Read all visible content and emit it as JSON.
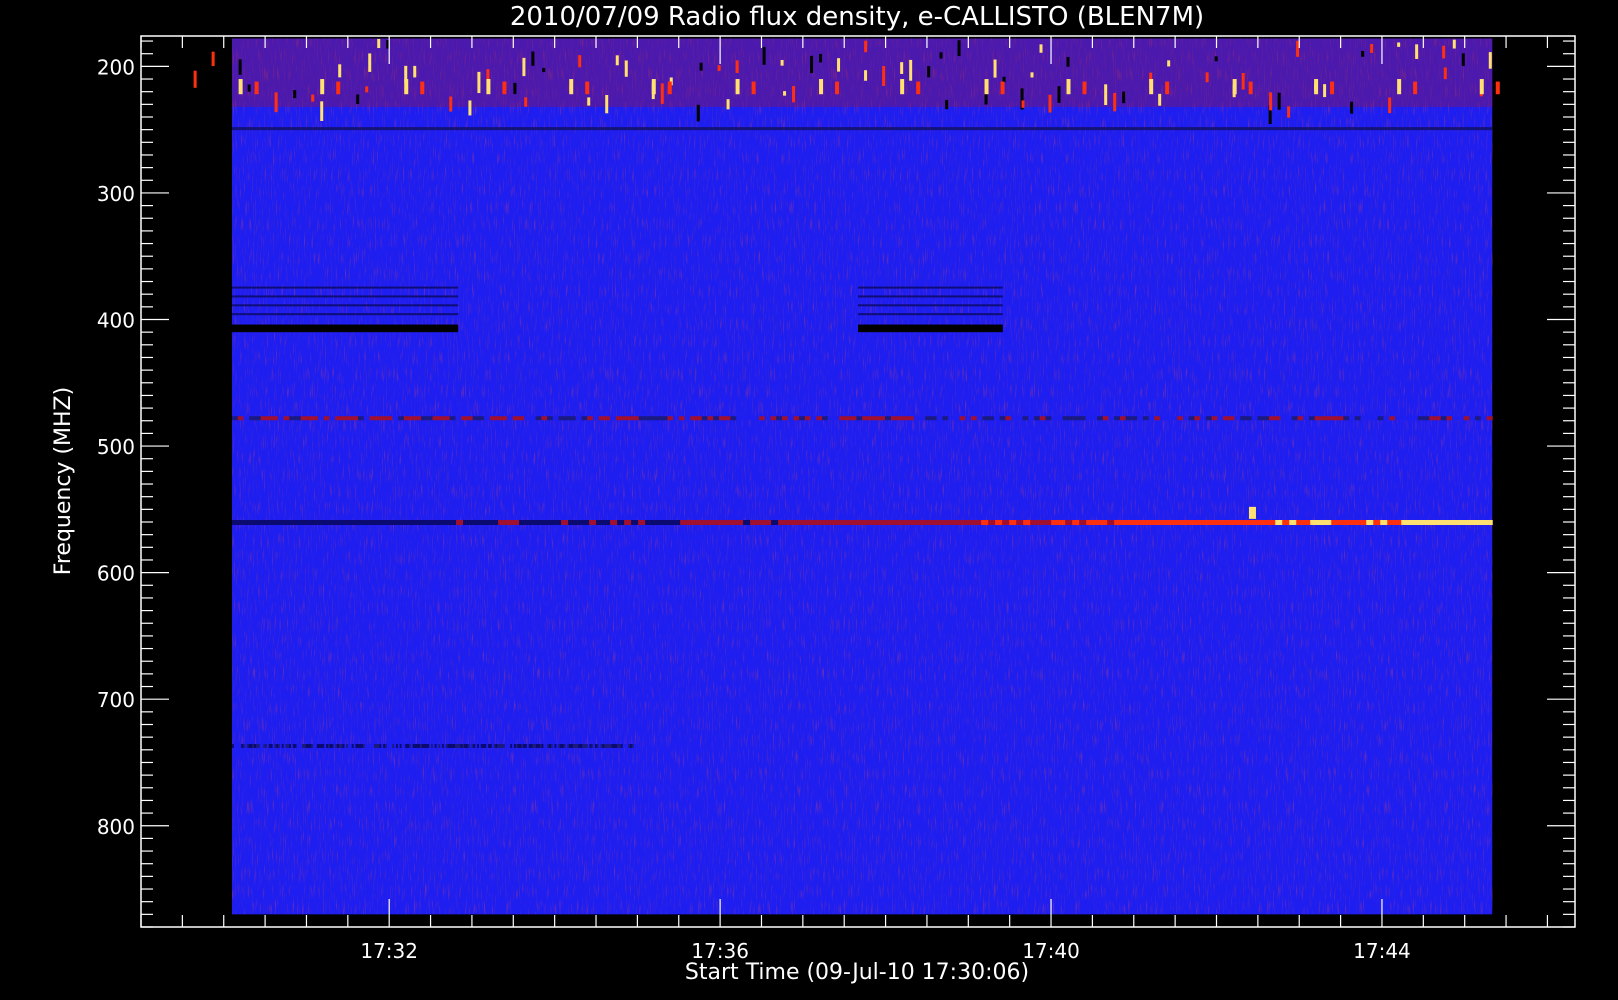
{
  "chart_data": {
    "type": "heatmap",
    "title": "2010/07/09  Radio flux density, e-CALLISTO (BLEN7M)",
    "xlabel": "Start Time (09-Jul-10 17:30:06)",
    "ylabel": "Frequency (MHZ)",
    "x_axis": {
      "unit": "minutes",
      "range": [
        "17:29:00",
        "17:46:20"
      ],
      "data_extent": [
        "17:30:06",
        "17:45:20"
      ],
      "major_ticks": [
        "17:32",
        "17:36",
        "17:40",
        "17:44"
      ],
      "minor_tick_step_minutes": 0.5,
      "ticks_on_top_axis": true
    },
    "y_axis": {
      "unit": "MHz",
      "inverted": true,
      "range": [
        176,
        880
      ],
      "data_extent": [
        178,
        870
      ],
      "major_ticks": [
        200,
        300,
        400,
        500,
        600,
        700,
        800
      ],
      "minor_tick_step": 10,
      "ticks_on_right_axis": true
    },
    "colormap": {
      "low": "#000000",
      "background": "#1e1ef0",
      "mid": "#a01030",
      "high": "#ff3010",
      "peak": "#ffe070"
    },
    "features": [
      {
        "name": "periodic interference bursts",
        "freq_range_mhz": [
          178,
          232
        ],
        "time_range": [
          "17:30:06",
          "17:45:20"
        ],
        "period_seconds": 60,
        "intensity": "high"
      },
      {
        "name": "dark band",
        "freq_range_mhz": [
          404,
          410
        ],
        "time_range": [
          "17:30:06",
          "17:32:50"
        ],
        "intensity": "very low"
      },
      {
        "name": "dark band",
        "freq_range_mhz": [
          404,
          410
        ],
        "time_range": [
          "17:37:40",
          "17:39:25"
        ],
        "intensity": "very low"
      },
      {
        "name": "narrowband emission line",
        "freq_mhz": 560,
        "time_range": [
          "17:30:06",
          "17:45:20"
        ],
        "intensity_start": "low",
        "intensity_end": "peak"
      },
      {
        "name": "emission line",
        "freq_mhz": 478,
        "time_range": [
          "17:30:06",
          "17:45:20"
        ],
        "intensity": "medium"
      },
      {
        "name": "dark line",
        "freq_mhz": 737,
        "time_range": [
          "17:30:06",
          "17:35:00"
        ],
        "intensity": "low"
      },
      {
        "name": "short flare",
        "freq_mhz": 552,
        "time": "17:42:25",
        "intensity": "peak"
      }
    ]
  }
}
